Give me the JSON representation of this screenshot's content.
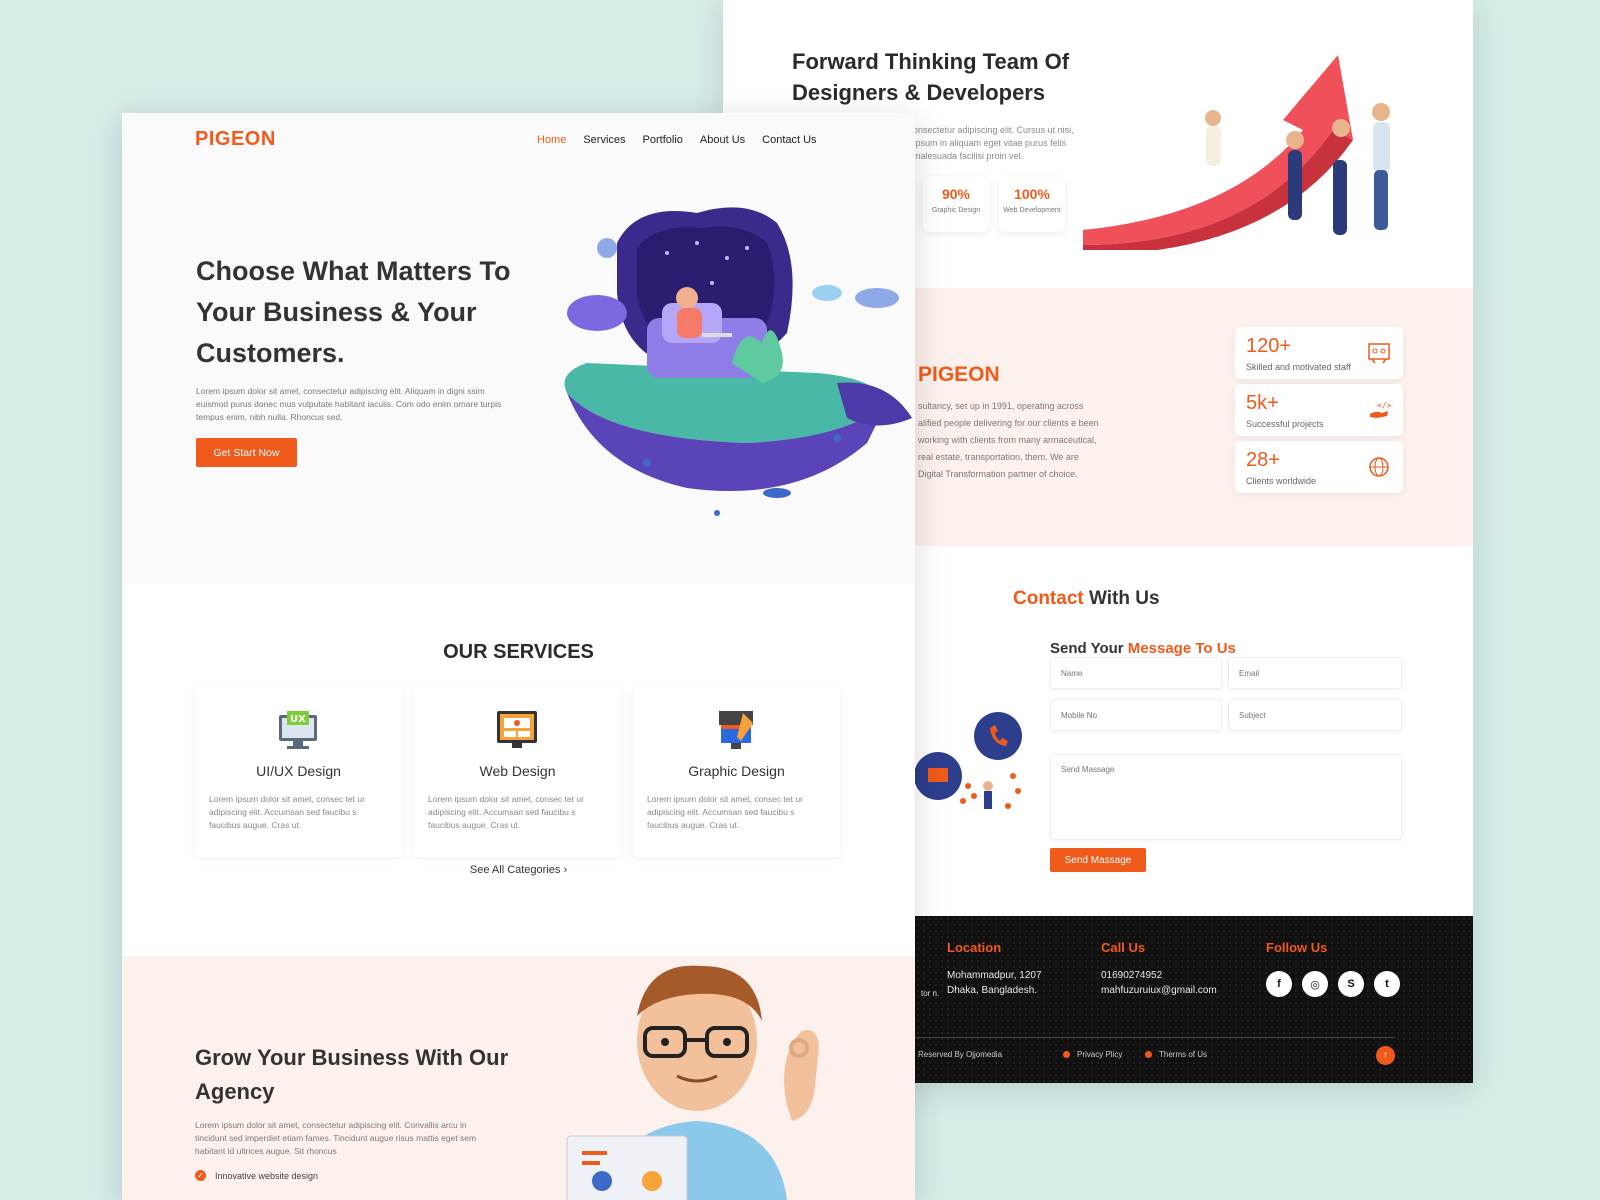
{
  "back": {
    "team": {
      "title": "Forward Thinking Team Of Designers & Developers",
      "text": "onsectetur adipiscing elit. Cursus ut nisi, Ipsum in aliquam eget vitae purus felis malesuada facilisi proin vel.",
      "stats": [
        {
          "value": "",
          "label": "n"
        },
        {
          "value": "90%",
          "label": "Graphic Design"
        },
        {
          "value": "100%",
          "label": "Web Development"
        }
      ]
    },
    "about": {
      "title": "PIGEON",
      "text": "sultancy, set up in 1991, operating across alified people delivering for our clients e been working with clients from many armaceutical, real estate, transportation, them. We are Digital Transformation partner of choice.",
      "stats": [
        {
          "value": "120+",
          "label": "Skilled and motivated staff",
          "icon": "team-board-icon"
        },
        {
          "value": "5k+",
          "label": "Successful projects",
          "icon": "code-hand-icon"
        },
        {
          "value": "28+",
          "label": "Clients worldwide",
          "icon": "globe-icon"
        }
      ]
    },
    "contact": {
      "title_accent": "Contact",
      "title_rest": " With Us",
      "sub_plain": "Send Your ",
      "sub_accent": "Message To Us",
      "fields": {
        "name": "Name",
        "email": "Email",
        "mobile": "Mobile No",
        "subject": "Subject",
        "message": "Send Massage"
      },
      "send_label": "Send Massage"
    },
    "footer": {
      "partial_text": "tor n.",
      "location_title": "Location",
      "location_text": "Mohammadpur, 1207 Dhaka, Bangladesh.",
      "call_title": "Call Us",
      "phone": "01690274952",
      "email": "mahfuzuruiux@gmail.com",
      "follow_title": "Follow  Us",
      "social": [
        {
          "icon": "facebook-icon",
          "glyph": "f"
        },
        {
          "icon": "instagram-icon",
          "glyph": "◎"
        },
        {
          "icon": "skype-icon",
          "glyph": "S"
        },
        {
          "icon": "twitter-icon",
          "glyph": "t"
        }
      ],
      "copyright": "Reserved By Ojjomedia",
      "privacy": "Privacy Plicy",
      "terms": "Therms of Us",
      "top_icon": "↑"
    }
  },
  "front": {
    "logo": "PIGEON",
    "nav": [
      "Home",
      "Services",
      "Portfolio",
      "About Us",
      "Contact Us"
    ],
    "hero": {
      "title": "Choose What Matters To Your Business & Your Customers.",
      "text": "Lorem ipsum dolor sit amet, consectetur adipiscing elit. Aliquam in digni ssim euismod purus donec mus vulputate habitant iaculis. Com odo enim ornare turpis tempus enim, nibh nulla. Rhoncus sed.",
      "button": "Get Start Now"
    },
    "services": {
      "title": "OUR SERVICES",
      "items": [
        {
          "name": "UI/UX Design",
          "text": "Lorem ipsum dolor sit amet, consec tet ur adipiscing elit. Accumsan sed faucibu s faucibus augue. Cras ut.",
          "icon": "ux-monitor-icon"
        },
        {
          "name": "Web Design",
          "text": "Lorem ipsum dolor sit amet, consec tet ur adipiscing elit. Accumsan sed faucibu s faucibus augue. Cras ut.",
          "icon": "web-design-icon"
        },
        {
          "name": "Graphic Design",
          "text": "Lorem ipsum dolor sit amet, consec tet ur adipiscing elit. Accumsan sed faucibu s faucibus augue. Cras ut.",
          "icon": "graphic-design-icon"
        }
      ],
      "see_all": "See All Categories ›"
    },
    "grow": {
      "title": "Grow Your Business With Our Agency",
      "text": "Lorem ipsum dolor sit amet, consectetur adipiscing elit. Convallis arcu in tincidunt sed imperdiet etiam fames. Tincidunt augue risus mattis eget sem habitant id ultrices augue. Sit rhoncus",
      "item": "Innovative website design"
    }
  }
}
